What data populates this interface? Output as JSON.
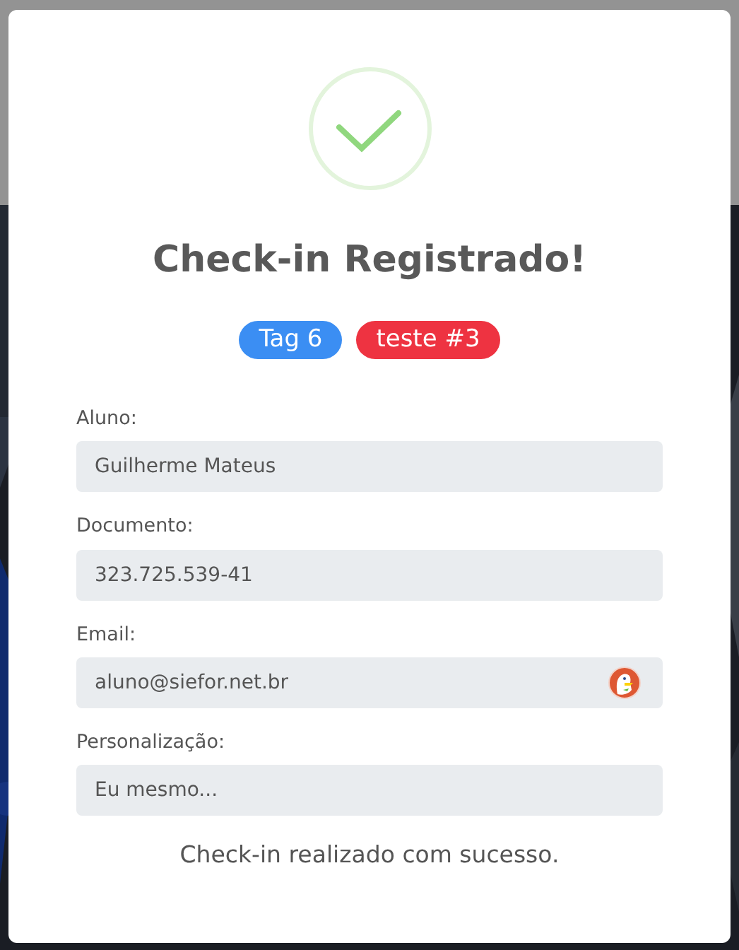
{
  "dialog": {
    "title": "Check-in Registrado!",
    "tags": [
      {
        "label": "Tag 6",
        "color": "#3b8ef3"
      },
      {
        "label": "teste #3",
        "color": "#ee3341"
      }
    ],
    "fields": [
      {
        "kind": "text",
        "label": "Aluno:",
        "value": "Guilherme Mateus"
      },
      {
        "kind": "text",
        "label": "Documento:",
        "value": "323.725.539-41"
      },
      {
        "kind": "email",
        "label": "Email:",
        "value": "aluno@siefor.net.br"
      },
      {
        "kind": "text",
        "label": "Personalização:",
        "value": "Eu mesmo..."
      }
    ],
    "message": "Check-in realizado com sucesso."
  }
}
